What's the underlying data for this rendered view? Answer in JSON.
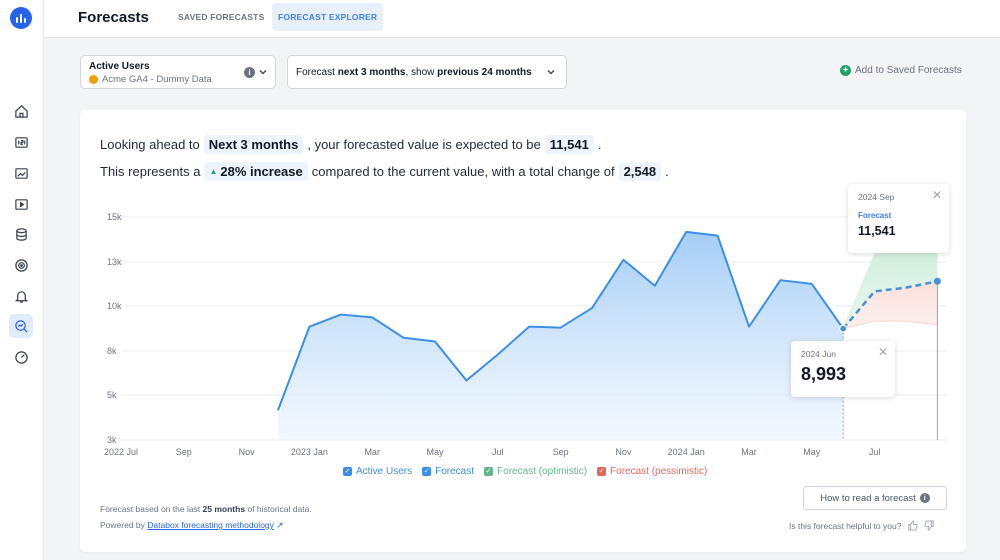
{
  "header": {
    "title": "Forecasts",
    "tabs": [
      {
        "label": "SAVED FORECASTS",
        "active": false
      },
      {
        "label": "FORECAST EXPLORER",
        "active": true
      }
    ]
  },
  "nav": {
    "items": [
      "home-icon",
      "number-icon",
      "databoard-icon",
      "player-icon",
      "stack-icon",
      "target-icon",
      "bell-icon",
      "forecast-icon",
      "gauge-icon"
    ],
    "active": "forecast-icon"
  },
  "metric_select": {
    "metric": "Active Users",
    "source": "Acme GA4 - Dummy Data"
  },
  "period_select": {
    "prefix": "Forecast ",
    "next": "next 3 months",
    "mid": ", show ",
    "prev": "previous 24 months"
  },
  "add_saved_label": "Add to Saved Forecasts",
  "summary": {
    "line1_a": "Looking ahead to",
    "horizon": "Next 3 months",
    "line1_b": ", your forecasted value is expected to be",
    "forecast_value": "11,541",
    "line1_c": ".",
    "line2_a": "This represents a",
    "increase": "28% increase",
    "line2_b": "compared to the current value, with a total change of",
    "change": "2,548",
    "line2_c": "."
  },
  "tooltips": {
    "sep": {
      "date": "2024 Sep",
      "series": "Forecast",
      "value": "11,541"
    },
    "jun": {
      "date": "2024 Jun",
      "value": "8,993"
    }
  },
  "colors": {
    "actual": "#3b8fe8",
    "actual_fill": "#bcdafa",
    "forecast": "#4a90d9",
    "optimistic": "#5fb78a",
    "pessimistic": "#e0685c",
    "grid": "#eceef1"
  },
  "chart_data": {
    "type": "area",
    "y_ticks": [
      "15k",
      "13k",
      "10k",
      "8k",
      "5k",
      "3k"
    ],
    "x_ticks": [
      "2022 Jul",
      "Sep",
      "Nov",
      "2023 Jan",
      "Mar",
      "May",
      "Jul",
      "Sep",
      "Nov",
      "2024 Jan",
      "Mar",
      "May",
      "Jul"
    ],
    "ylim": [
      3000,
      15000
    ],
    "grid": true,
    "legend_position": "bottom",
    "series": [
      {
        "name": "Active Users",
        "x": [
          "2022 Dec",
          "2023 Jan",
          "2023 Feb",
          "2023 Mar",
          "2023 Apr",
          "2023 May",
          "2023 Jun",
          "2023 Jul",
          "2023 Aug",
          "2023 Sep",
          "2023 Oct",
          "2023 Nov",
          "2023 Dec",
          "2024 Jan",
          "2024 Feb",
          "2024 Mar",
          "2024 Apr",
          "2024 May",
          "2024 Jun"
        ],
        "values": [
          4600,
          9100,
          9750,
          9600,
          8500,
          8300,
          6200,
          7600,
          9100,
          9050,
          10100,
          12700,
          11300,
          14200,
          14000,
          9100,
          11600,
          11400,
          8993
        ]
      },
      {
        "name": "Forecast",
        "x": [
          "2024 Jun",
          "2024 Jul",
          "2024 Aug",
          "2024 Sep"
        ],
        "values": [
          8993,
          11000,
          11200,
          11541
        ]
      },
      {
        "name": "Forecast (optimistic)",
        "x": [
          "2024 Jun",
          "2024 Jul",
          "2024 Aug",
          "2024 Sep"
        ],
        "values": [
          8993,
          13000,
          13600,
          13600
        ]
      },
      {
        "name": "Forecast (pessimistic)",
        "x": [
          "2024 Jun",
          "2024 Jul",
          "2024 Aug",
          "2024 Sep"
        ],
        "values": [
          8993,
          9400,
          9400,
          9200
        ]
      }
    ]
  },
  "legend": [
    {
      "label": "Active Users",
      "color": "#3b8fe8"
    },
    {
      "label": "Forecast",
      "color": "#3b8fe8"
    },
    {
      "label": "Forecast (optimistic)",
      "color": "#5fb78a"
    },
    {
      "label": "Forecast (pessimistic)",
      "color": "#e0685c"
    }
  ],
  "footer": {
    "note_a": "Forecast based on the last",
    "note_b": "25 months",
    "note_c": "of historical data.",
    "powered_a": "Powered by",
    "powered_link": "Databox forecasting methodology",
    "howto_label": "How to read a forecast",
    "helpful_label": "Is this forecast helpful to you?"
  }
}
